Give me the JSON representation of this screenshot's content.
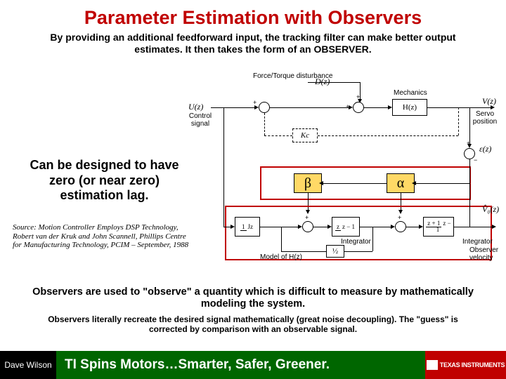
{
  "title": "Parameter Estimation with Observers",
  "subtitle": "By providing an additional feedforward input, the tracking filter can make better output estimates.  It then takes the form of an OBSERVER.",
  "side_note": "Can be designed to have zero (or near zero) estimation lag.",
  "source": "Source:  Motion Controller Employs DSP Technology, Robert van der Kruk and John Scannell, Phillips Centre for Manufacturing Technology, PCIM – September, 1988",
  "diagram": {
    "top_label": "Force/Torque disturbance",
    "dist_sym": "D(z)",
    "ctrl_sig": "Control signal",
    "u_sym": "U(z)",
    "mechanics": "Mechanics",
    "hz": "H(z)",
    "servo_pos": "Servo position",
    "v_sym": "V(z)",
    "err_sym": "ε(z)",
    "beta": "β",
    "alpha": "α",
    "model_hz": "Model of H(z)",
    "integrator": "Integrator",
    "obs_vel": "Observer velocity",
    "vhat": "V̂₀(z)",
    "tf_int1_num": "z",
    "tf_int1_den": "z − 1",
    "tf_int2_num": "z + 1",
    "tf_int2_den": "z − 1",
    "tf_mdl_num": "1",
    "tf_mdl_den": "Jz",
    "half": "½",
    "kc": "Kc"
  },
  "bottom1": "Observers are used to \"observe\" a quantity which is difficult to measure by mathematically modeling the system.",
  "bottom2": "Observers literally recreate the desired signal mathematically (great noise decoupling). The \"guess\" is corrected by comparison with an observable signal.",
  "footer": {
    "author": "Dave Wilson",
    "tagline": "TI Spins Motors…Smarter, Safer, Greener.",
    "brand": "TEXAS INSTRUMENTS"
  }
}
